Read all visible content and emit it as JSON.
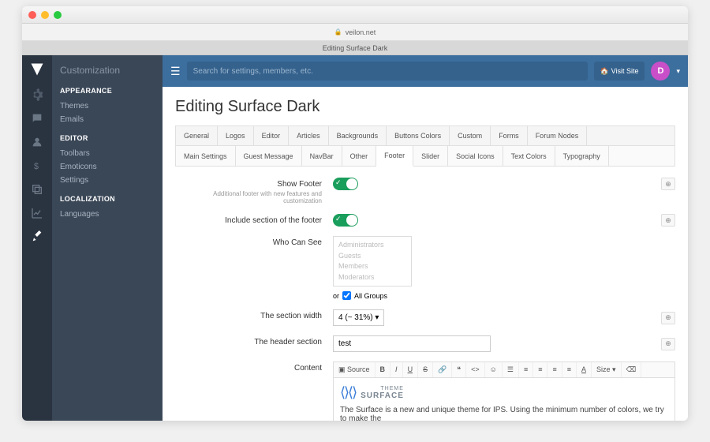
{
  "browser": {
    "url": "veilon.net",
    "tab": "Editing Surface Dark"
  },
  "topbar": {
    "search_placeholder": "Search for settings, members, etc.",
    "visit": "Visit Site",
    "avatar": "D"
  },
  "sidebar": {
    "title": "Customization",
    "sections": [
      {
        "heading": "APPEARANCE",
        "items": [
          "Themes",
          "Emails"
        ]
      },
      {
        "heading": "EDITOR",
        "items": [
          "Toolbars",
          "Emoticons",
          "Settings"
        ]
      },
      {
        "heading": "LOCALIZATION",
        "items": [
          "Languages"
        ]
      }
    ]
  },
  "page": {
    "title": "Editing Surface Dark"
  },
  "tabs1": [
    "General",
    "Logos",
    "Editor",
    "Articles",
    "Backgrounds",
    "Buttons Colors",
    "Custom",
    "Forms",
    "Forum Nodes"
  ],
  "tabs2": [
    "Main Settings",
    "Guest Message",
    "NavBar",
    "Other",
    "Footer",
    "Slider",
    "Social Icons",
    "Text Colors",
    "Typography"
  ],
  "active_tab2": "Footer",
  "form": {
    "show_footer": {
      "label": "Show Footer",
      "hint": "Additional footer with new features and customization",
      "value": true
    },
    "include_section": {
      "label": "Include section of the footer",
      "value": true
    },
    "who_can_see": {
      "label": "Who Can See",
      "options": [
        "Administrators",
        "Guests",
        "Members",
        "Moderators"
      ],
      "or": "or",
      "all_groups": "All Groups",
      "all_checked": true
    },
    "section_width": {
      "label": "The section width",
      "value": "4 (~ 31%)"
    },
    "header_section": {
      "label": "The header section",
      "value": "test"
    },
    "content": {
      "label": "Content",
      "source_btn": "Source",
      "logo_theme": "THEME",
      "logo_name": "SURFACE",
      "text": "The Surface is a new and unique theme for IPS. Using the minimum number of colors, we try to make the"
    }
  }
}
